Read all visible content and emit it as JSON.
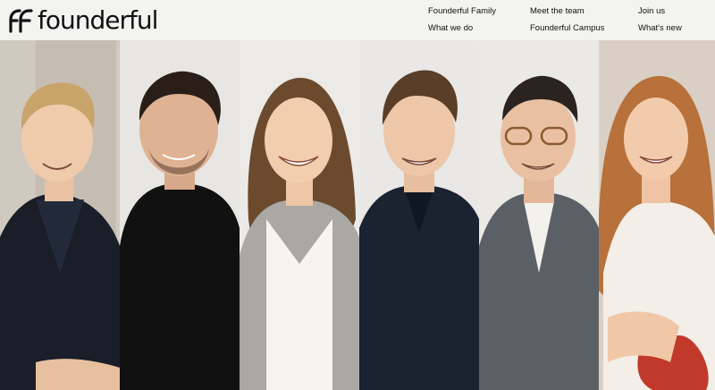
{
  "brand": {
    "name": "founderful",
    "accent": "#111111"
  },
  "nav": {
    "founderful_family": "Founderful Family",
    "what_we_do": "What we do",
    "meet_the_team": "Meet the team",
    "founderful_campus": "Founderful Campus",
    "join_us": "Join us",
    "whats_new": "What's new"
  },
  "team_photos": [
    {
      "icon": "person-photo",
      "bg": "#cfc9c0",
      "shirt": "#1a1e28",
      "hair": "#c8a46a"
    },
    {
      "icon": "person-photo",
      "bg": "#e8e6e2",
      "shirt": "#111111",
      "hair": "#2a1f18"
    },
    {
      "icon": "person-photo",
      "bg": "#eceae6",
      "shirt": "#a9a8a4",
      "hair": "#6b4a2e"
    },
    {
      "icon": "person-photo",
      "bg": "#e9e8e6",
      "shirt": "#1b2230",
      "hair": "#5a3e28"
    },
    {
      "icon": "person-photo",
      "bg": "#ebe9e4",
      "shirt": "#5b5f66",
      "hair": "#2b2320"
    },
    {
      "icon": "person-photo",
      "bg": "#d9cfc4",
      "shirt": "#f3eee8",
      "hair": "#b8713a"
    }
  ]
}
